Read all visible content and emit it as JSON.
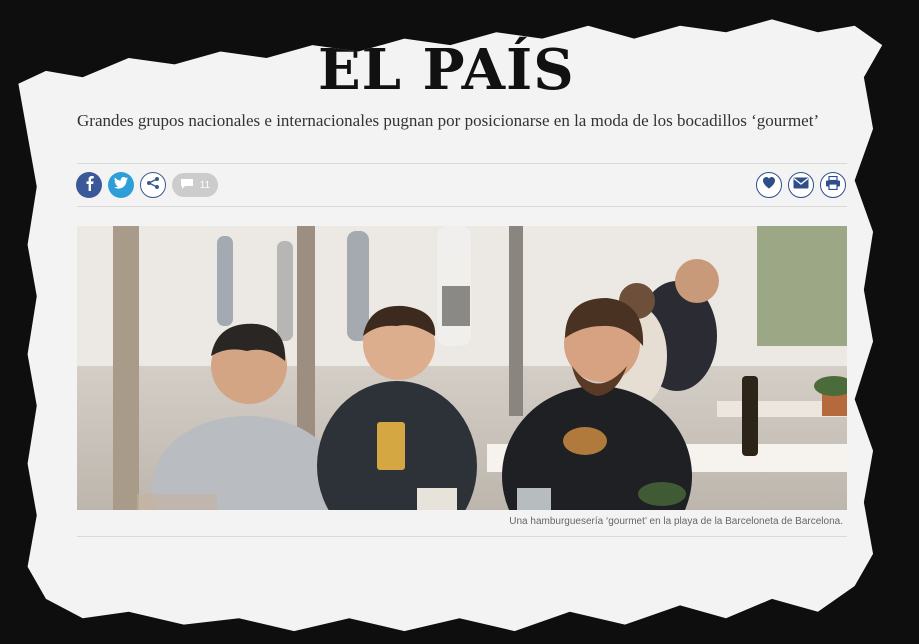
{
  "brand": {
    "logo_text": "EL PAÍS"
  },
  "article": {
    "headline": "Grandes grupos nacionales e internacionales pugnan por posicionarse en la moda de los bocadillos ‘gourmet’",
    "comments_count": "11",
    "caption": "Una hamburguesería ‘gourmet’ en la playa de la Barceloneta de Barcelona."
  },
  "share": {
    "left": [
      "facebook-icon",
      "twitter-icon",
      "share-icon",
      "comments-icon"
    ],
    "right": [
      "heart-icon",
      "mail-icon",
      "print-icon"
    ]
  },
  "colors": {
    "facebook": "#3b5998",
    "twitter": "#2e9ed8",
    "accent": "#2f4f8a",
    "paper": "#f3f3f3"
  }
}
